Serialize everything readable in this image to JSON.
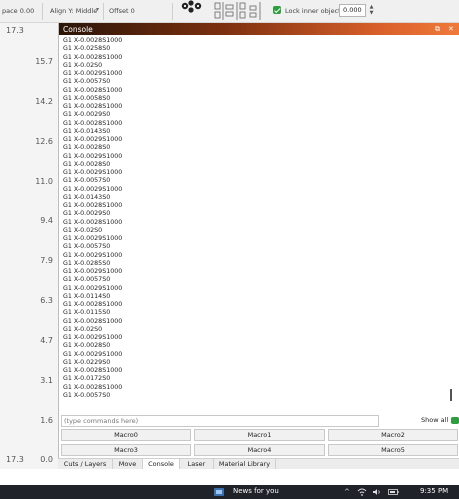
{
  "toolbar": {
    "space_label": "pace 0.00",
    "align_y_label": "Align Y: Middle",
    "offset_label": "Offset 0",
    "lock_label": "Lock inner objects",
    "lock_value": "0.000",
    "colors": {
      "check": "#2e9e3e"
    },
    "icons": [
      "chevron-down-icon",
      "cluster-icon",
      "align-icons",
      "spin-up-icon",
      "spin-down-icon"
    ]
  },
  "ruler": {
    "top": "17.3",
    "bottom": "17.3",
    "marks": [
      "15.7",
      "14.2",
      "12.6",
      "11.0",
      "9.4",
      "7.9",
      "6.3",
      "4.7",
      "3.1",
      "1.6",
      "0.0"
    ]
  },
  "console": {
    "title": "Console",
    "title_buttons": [
      "⧉",
      "✕"
    ],
    "lines": [
      "G1 X-0.0028S1000",
      "G1 X-0.0258S0",
      "G1 X-0.0028S1000",
      "G1 X-0.02S0",
      "G1 X-0.0029S1000",
      "G1 X-0.0057S0",
      "G1 X-0.0028S1000",
      "G1 X-0.0058S0",
      "G1 X-0.0028S1000",
      "G1 X-0.0029S0",
      "G1 X-0.0028S1000",
      "G1 X-0.0143S0",
      "G1 X-0.0029S1000",
      "G1 X-0.0028S0",
      "G1 X-0.0029S1000",
      "G1 X-0.0028S0",
      "G1 X-0.0029S1000",
      "G1 X-0.0057S0",
      "G1 X-0.0029S1000",
      "G1 X-0.0143S0",
      "G1 X-0.0028S1000",
      "G1 X-0.0029S0",
      "G1 X-0.0028S1000",
      "G1 X-0.02S0",
      "G1 X-0.0029S1000",
      "G1 X-0.0057S0",
      "G1 X-0.0029S1000",
      "G1 X-0.0285S0",
      "G1 X-0.0029S1000",
      "G1 X-0.0057S0",
      "G1 X-0.0029S1000",
      "G1 X-0.0114S0",
      "G1 X-0.0028S1000",
      "G1 X-0.0115S0",
      "G1 X-0.0028S1000",
      "G1 X-0.02S0",
      "G1 X-0.0029S1000",
      "G1 X-0.0028S0",
      "G1 X-0.0029S1000",
      "G1 X-0.0229S0",
      "G1 X-0.0028S1000",
      "G1 X-0.0172S0",
      "G1 X-0.0028S1000",
      "G1 X-0.0057S0"
    ],
    "input_placeholder": "(type commands here)",
    "show_all_label": "Show all",
    "macros": [
      "Macro0",
      "Macro1",
      "Macro2",
      "Macro3",
      "Macro4",
      "Macro5"
    ]
  },
  "tabs": [
    "Cuts / Layers",
    "Move",
    "Console",
    "Laser",
    "Material Library"
  ],
  "active_tab": "Console",
  "taskbar": {
    "news_label": "News for you",
    "clock": "9:35 PM",
    "tray_icons": [
      "chevron-up-icon",
      "network-icon",
      "speaker-icon",
      "battery-icon"
    ]
  }
}
